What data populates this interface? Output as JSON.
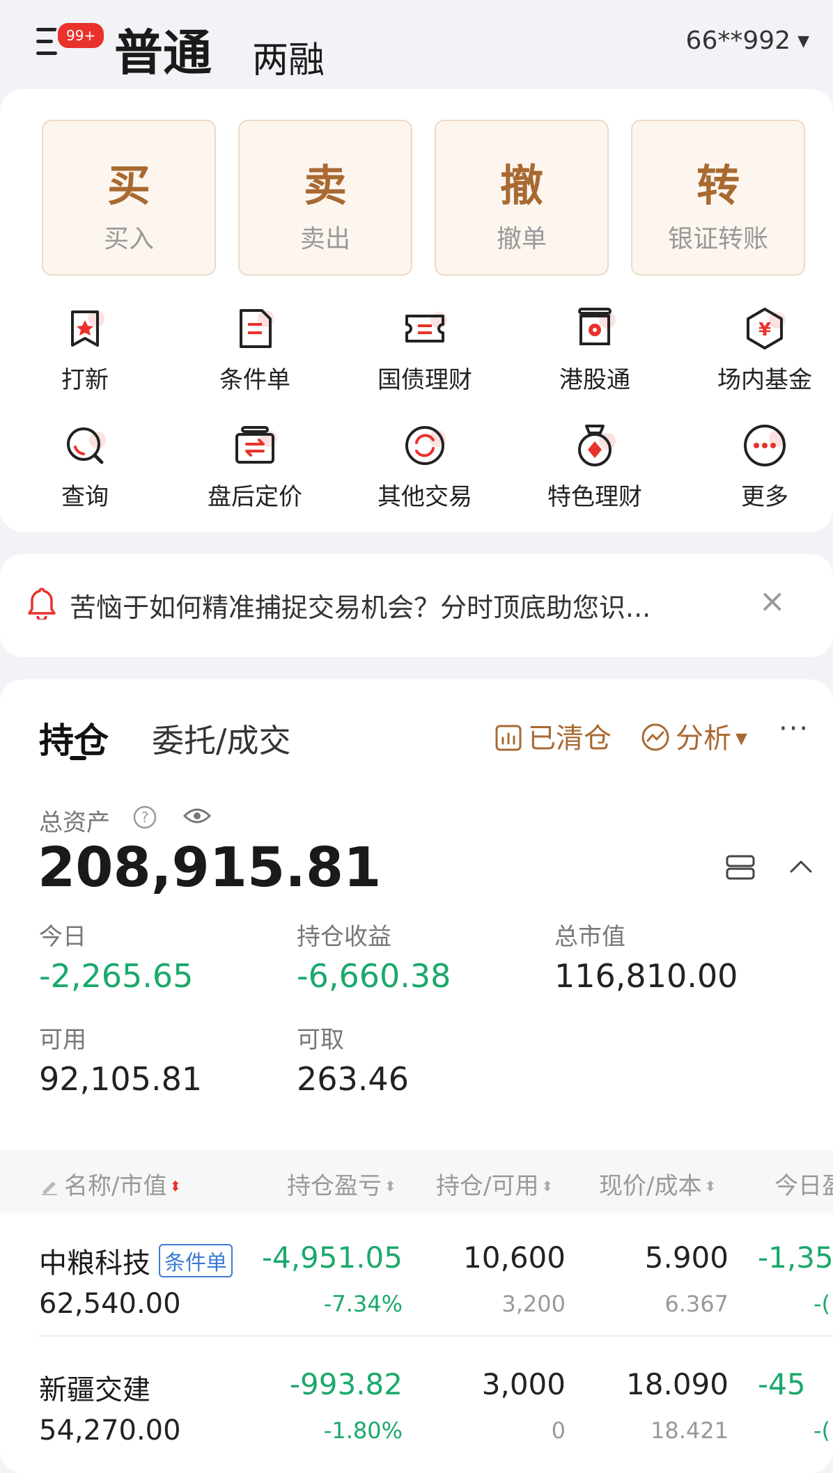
{
  "header": {
    "badge": "99+",
    "tab_normal": "普通",
    "tab_margin": "两融",
    "account": "66**992"
  },
  "big_actions": [
    {
      "title": "买",
      "sub": "买入"
    },
    {
      "title": "卖",
      "sub": "卖出"
    },
    {
      "title": "撤",
      "sub": "撤单"
    },
    {
      "title": "转",
      "sub": "银证转账"
    }
  ],
  "grid": [
    {
      "label": "打新",
      "icon": "ipo-icon"
    },
    {
      "label": "条件单",
      "icon": "conditional-order-icon"
    },
    {
      "label": "国债理财",
      "icon": "bond-icon"
    },
    {
      "label": "港股通",
      "icon": "hk-connect-icon"
    },
    {
      "label": "场内基金",
      "icon": "fund-icon"
    },
    {
      "label": "查询",
      "icon": "query-icon"
    },
    {
      "label": "盘后定价",
      "icon": "after-hours-icon"
    },
    {
      "label": "其他交易",
      "icon": "other-trade-icon"
    },
    {
      "label": "特色理财",
      "icon": "featured-wealth-icon"
    },
    {
      "label": "更多",
      "icon": "more-icon"
    }
  ],
  "notice": {
    "text": "苦恼于如何精准捕捉交易机会？分时顶底助您识...",
    "close": "×"
  },
  "positions": {
    "tab_active": "持仓",
    "tab_orders": "委托/成交",
    "cleared": "已清仓",
    "analysis": "分析",
    "more": "···",
    "total_label": "总资产",
    "total_value": "208,915.81",
    "stats": {
      "today_label": "今日",
      "today_value": "-2,265.65",
      "pnl_label": "持仓收益",
      "pnl_value": "-6,660.38",
      "mv_label": "总市值",
      "mv_value": "116,810.00",
      "avail_label": "可用",
      "avail_value": "92,105.81",
      "withdraw_label": "可取",
      "withdraw_value": "263.46"
    },
    "columns": {
      "name": "名称/市值",
      "pnl": "持仓盈亏",
      "qty": "持仓/可用",
      "price": "现价/成本",
      "today": "今日盈"
    },
    "rows": [
      {
        "name": "中粮科技",
        "tag": "条件单",
        "mv": "62,540.00",
        "pnl": "-4,951.05",
        "pnl_pct": "-7.34%",
        "qty": "10,600",
        "avail": "3,200",
        "price": "5.900",
        "cost": "6.367",
        "today": "-1,35",
        "today_pct": "-("
      },
      {
        "name": "新疆交建",
        "tag": "",
        "mv": "54,270.00",
        "pnl": "-993.82",
        "pnl_pct": "-1.80%",
        "qty": "3,000",
        "avail": "0",
        "price": "18.090",
        "cost": "18.421",
        "today": "-45",
        "today_pct": "-("
      }
    ]
  }
}
